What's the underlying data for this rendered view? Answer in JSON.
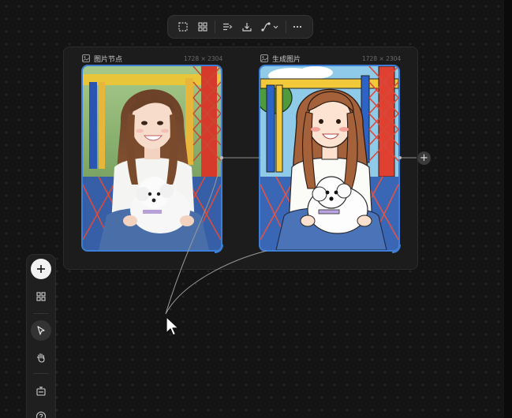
{
  "top_toolbar": {
    "items": [
      {
        "name": "select-frame",
        "icon": "frame-select-icon"
      },
      {
        "name": "grid-layout",
        "icon": "grid-icon"
      },
      {
        "name": "align",
        "icon": "align-icon"
      },
      {
        "name": "download",
        "icon": "download-icon"
      },
      {
        "name": "connector-style",
        "icon": "connector-icon"
      },
      {
        "name": "more",
        "icon": "more-icon",
        "label": "···"
      }
    ]
  },
  "nodes": [
    {
      "title": "图片节点",
      "dimensions": "1728 × 2304"
    },
    {
      "title": "生成图片",
      "dimensions": "1728 × 2304"
    }
  ],
  "add_node_label": "+",
  "left_toolbar": {
    "items": [
      {
        "name": "add",
        "icon": "plus-icon"
      },
      {
        "name": "components",
        "icon": "grid-icon"
      },
      {
        "name": "select",
        "icon": "pointer-icon"
      },
      {
        "name": "pan",
        "icon": "hand-icon"
      },
      {
        "name": "board",
        "icon": "board-icon"
      },
      {
        "name": "help",
        "icon": "help-icon"
      }
    ]
  },
  "colors": {
    "canvas": "#141414",
    "frame": "#1c1c1c",
    "accent": "#3d7fd8"
  }
}
